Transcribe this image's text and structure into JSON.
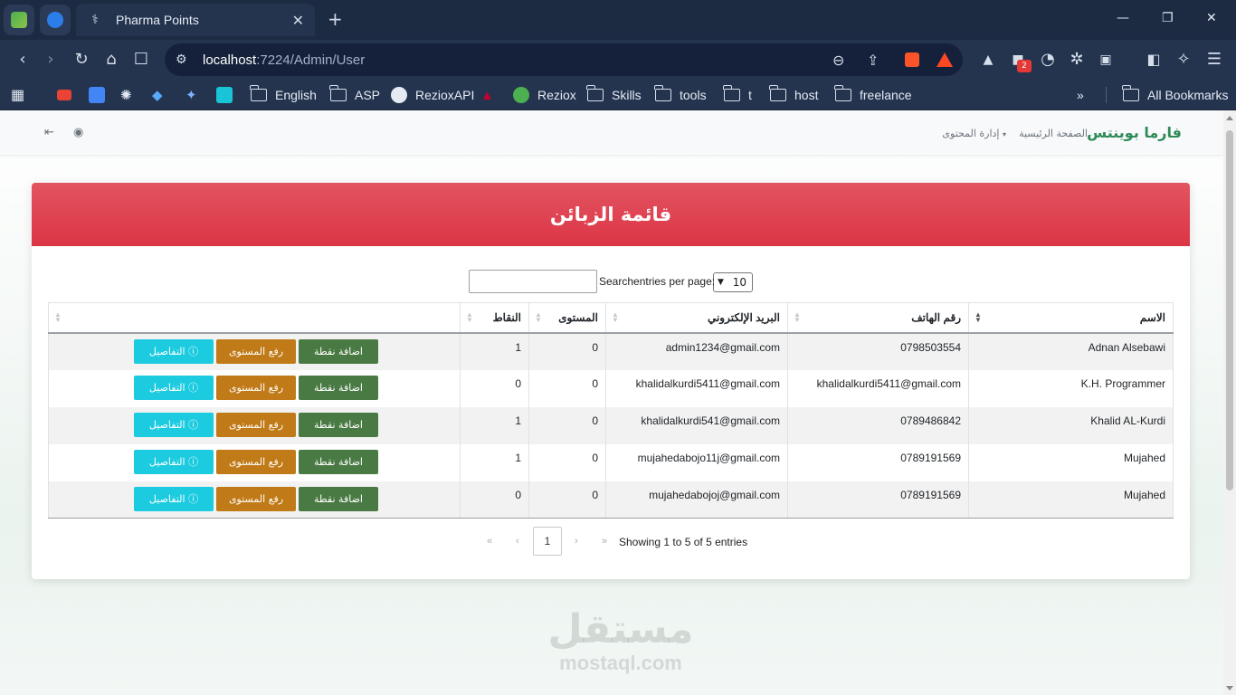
{
  "browser": {
    "tab_title": "Pharma Points",
    "url_host": "localhost",
    "url_path": ":7224/Admin/User",
    "extension_badge": "2",
    "bookmarks": [
      "English",
      "ASP",
      "RezioxAPI",
      "Reziox",
      "Skills",
      "tools",
      "t",
      "host",
      "freelance"
    ],
    "all_bookmarks": "All Bookmarks"
  },
  "navbar": {
    "brand": "فارما بوينتس",
    "home": "الصفحة الرئيسية",
    "content_management": "إدارة المحتوى"
  },
  "card": {
    "title": "قائمة الزبائن"
  },
  "table_controls": {
    "length_value": "10",
    "length_label": "Searchentries per page:",
    "search_value": ""
  },
  "table": {
    "columns": [
      "الاسم",
      "رقم الهاتف",
      "البريد الإلكتروني",
      "المستوى",
      "النقاط",
      ""
    ],
    "rows": [
      {
        "name": "Adnan Alsebawi",
        "phone": "0798503554",
        "email": "admin1234@gmail.com",
        "level": "0",
        "points": "1"
      },
      {
        "name": "K.H. Programmer",
        "phone": "khalidalkurdi5411@gmail.com",
        "email": "khalidalkurdi5411@gmail.com",
        "level": "0",
        "points": "0"
      },
      {
        "name": "Khalid AL-Kurdi",
        "phone": "0789486842",
        "email": "khalidalkurdi541@gmail.com",
        "level": "0",
        "points": "1"
      },
      {
        "name": "Mujahed",
        "phone": "0789191569",
        "email": "mujahedabojo11j@gmail.com",
        "level": "0",
        "points": "1"
      },
      {
        "name": "Mujahed",
        "phone": "0789191569",
        "email": "mujahedabojoj@gmail.com",
        "level": "0",
        "points": "0"
      }
    ],
    "actions": {
      "add_point": "اضافة نقطة",
      "raise_level": "رفع المستوى",
      "details": "التفاصيل"
    }
  },
  "pagination": {
    "info": "Showing 1 to 5 of 5 entries",
    "current_page": "1",
    "first": "«",
    "prev": "‹",
    "next": "›",
    "last": "»"
  },
  "watermark": {
    "arabic": "مستقل",
    "latin": "mostaql.com"
  },
  "colors": {
    "header_red": "#dc3545",
    "brand_green": "#2e8b57",
    "add_button": "#4a7a43",
    "raise_button": "#c07a17",
    "details_button": "#1ccbe0",
    "browser_chrome": "#1c2a42"
  }
}
